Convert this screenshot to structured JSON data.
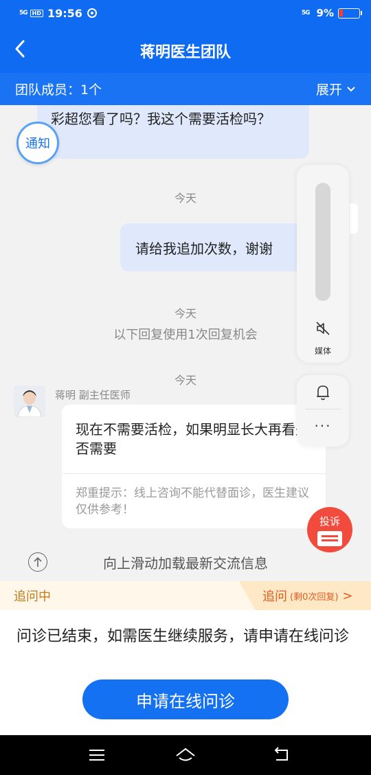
{
  "status_bar": {
    "signal_left": "5G",
    "hd": "HD",
    "time": "19:56",
    "signal_right": "5G",
    "battery": "9%",
    "colors": {
      "battery_low": "#ff3b30"
    }
  },
  "header": {
    "title": "蒋明医生团队",
    "back_icon": "chevron-left-icon"
  },
  "team_bar": {
    "members_label": "团队成员：1个",
    "expand_label": "展开"
  },
  "chat": {
    "messages": [
      {
        "from": "patient",
        "text": "彩超您看了吗？我这个需要活检吗？"
      },
      {
        "type": "timestamp",
        "text": "今天"
      },
      {
        "from": "patient",
        "text": "请给我追加次数，谢谢"
      },
      {
        "type": "timestamp",
        "text": "今天"
      },
      {
        "type": "system",
        "text": "以下回复使用1次回复机会"
      },
      {
        "type": "timestamp",
        "text": "今天"
      },
      {
        "from": "doctor",
        "name": "蒋明",
        "title": "副主任医师",
        "text": "现在不需要活检，如果明显长大再看是否需要",
        "tip": "郑重提示：线上咨询不能代替面诊，医生建议仅供参考！"
      }
    ],
    "notify_badge": "通知",
    "load_more": "向上滑动加载最新交流信息"
  },
  "floating_panel": {
    "media_label": "媒体",
    "more_label": "···"
  },
  "complaint": {
    "label": "投诉"
  },
  "follow_bar": {
    "state": "追问中",
    "ask_label": "追问",
    "remaining": "(剩0次回复)",
    "arrow": ">"
  },
  "bottom": {
    "ended_text": "问诊已结束，如需医生继续服务，请申请在线问诊",
    "apply_button": "申请在线问诊"
  },
  "colors": {
    "primary": "#0f6bf2",
    "complaint": "#f04b3c",
    "follow_accent": "#e35b1b"
  }
}
